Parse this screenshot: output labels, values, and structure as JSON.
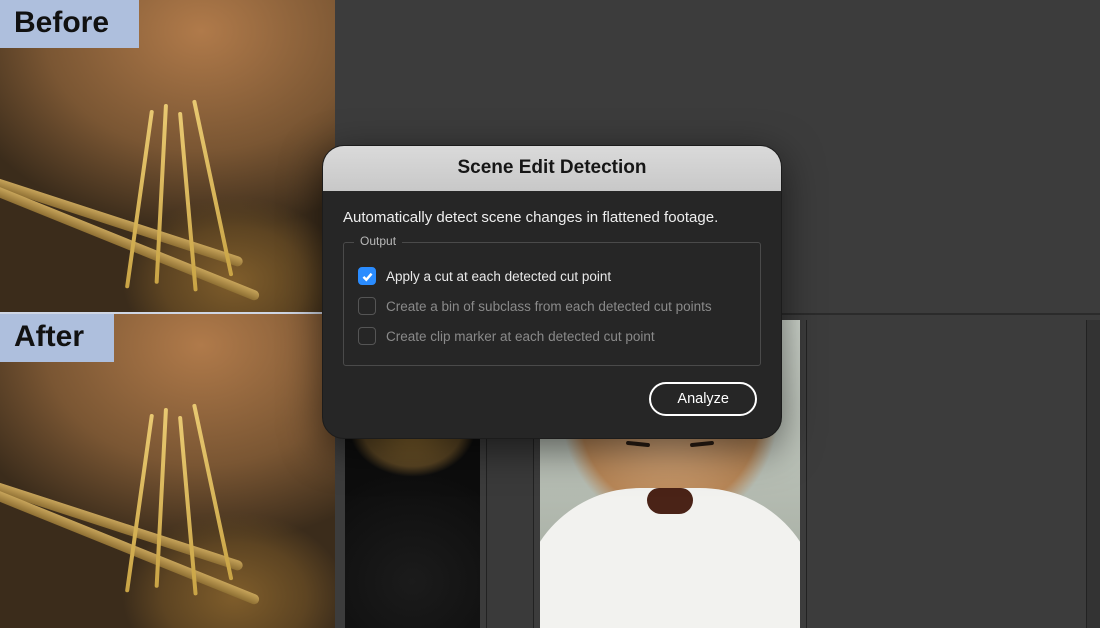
{
  "comparison": {
    "before_label": "Before",
    "after_label": "After"
  },
  "dialog": {
    "title": "Scene Edit Detection",
    "description": "Automatically detect scene changes in flattened footage.",
    "fieldset_label": "Output",
    "options": [
      {
        "label": "Apply a cut at each detected cut point",
        "checked": true,
        "enabled": true
      },
      {
        "label": "Create a bin of subclass from each detected cut points",
        "checked": false,
        "enabled": false
      },
      {
        "label": "Create clip marker at each detected cut point",
        "checked": false,
        "enabled": false
      }
    ],
    "actions": {
      "analyze": "Analyze"
    }
  },
  "colors": {
    "accent": "#2a8cff",
    "badge_bg": "#aebfdd"
  }
}
